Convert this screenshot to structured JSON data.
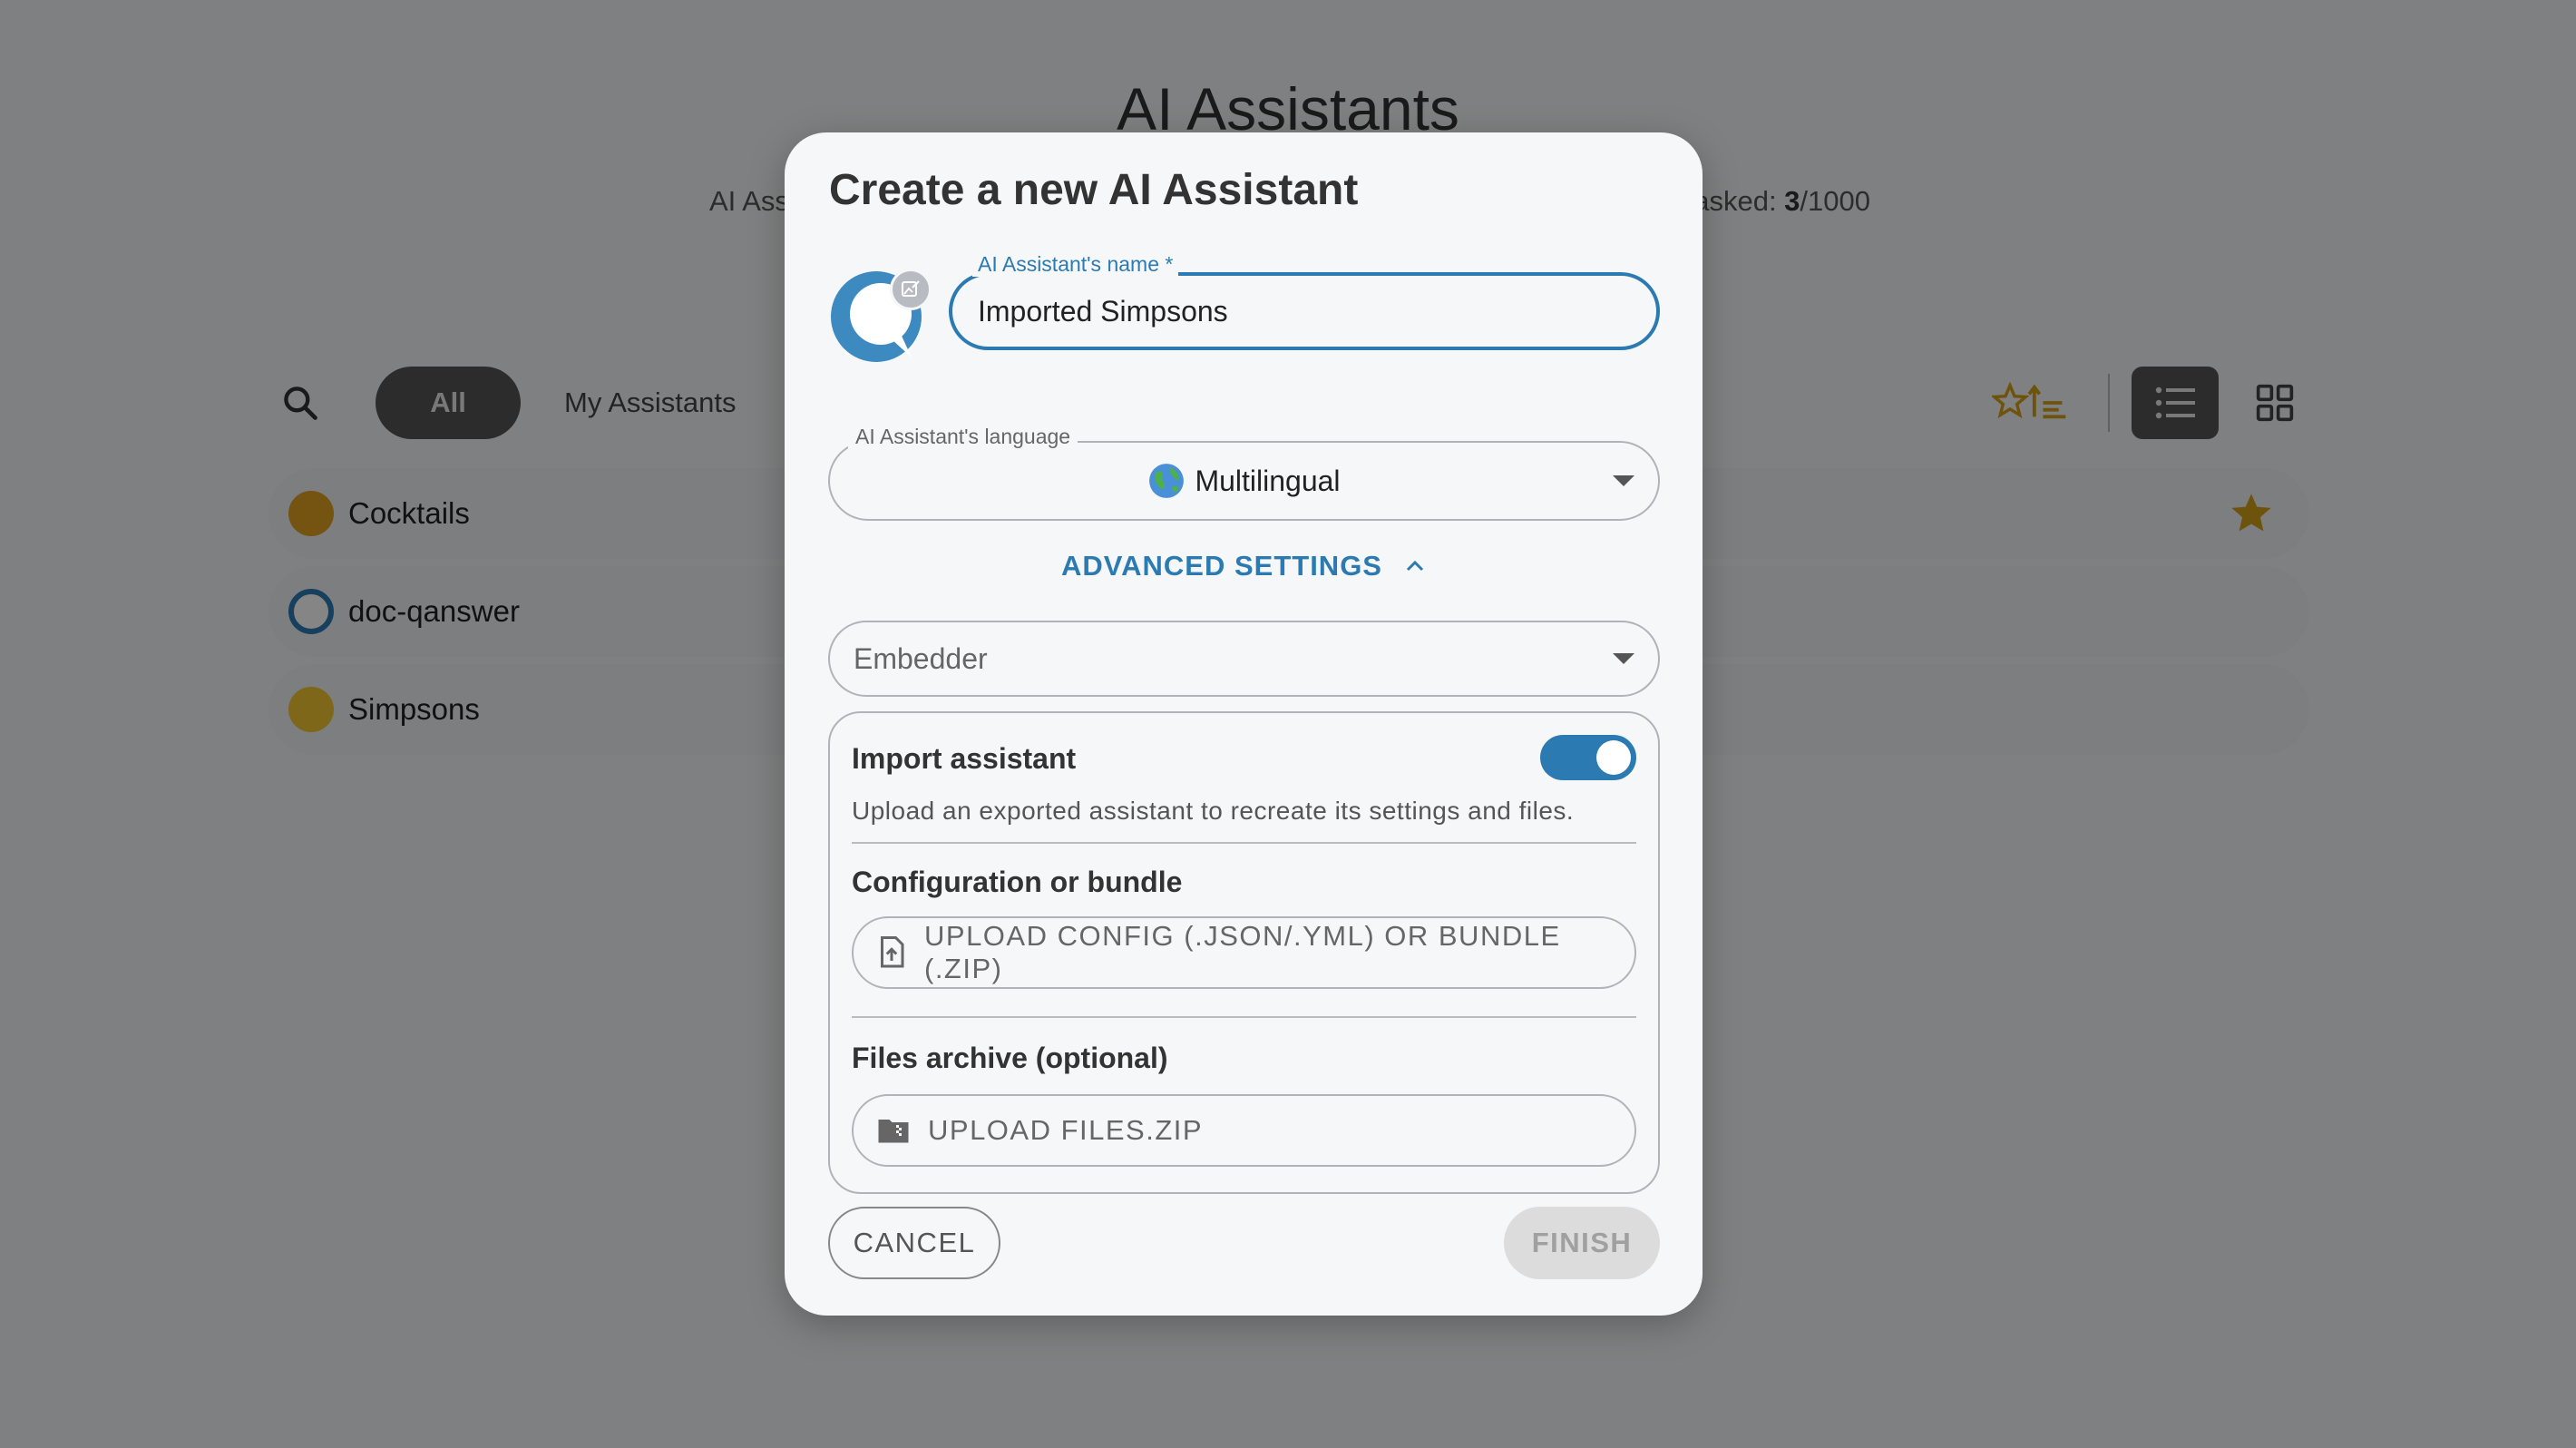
{
  "page": {
    "title": "AI Assistants",
    "stats_left": "AI Assistants",
    "stats_right_prefix": "Questions asked: ",
    "stats_used": "3",
    "stats_total": "/1000"
  },
  "filters": {
    "all_label": "All",
    "mine_label": "My Assistants"
  },
  "assistants": [
    {
      "name": "Cocktails",
      "favorite": true
    },
    {
      "name": "doc-qanswer",
      "favorite": false
    },
    {
      "name": "Simpsons",
      "favorite": false
    }
  ],
  "modal": {
    "title": "Create a new AI Assistant",
    "name_label": "AI Assistant's name *",
    "name_value": "Imported Simpsons",
    "language_label": "AI Assistant's language",
    "language_value": "Multilingual",
    "advanced_label": "ADVANCED SETTINGS",
    "embedder_placeholder": "Embedder",
    "import": {
      "title": "Import assistant",
      "enabled": true,
      "description": "Upload an exported assistant to recreate its settings and files.",
      "config_title": "Configuration or bundle",
      "config_button": "UPLOAD CONFIG (.JSON/.YML) OR BUNDLE (.ZIP)",
      "files_title": "Files archive (optional)",
      "files_button": "UPLOAD FILES.ZIP"
    },
    "cancel_label": "CANCEL",
    "finish_label": "FINISH"
  },
  "colors": {
    "accent": "#2b7bb2",
    "favorite": "#d4a017",
    "overlay": "rgba(0,0,0,0.48)"
  }
}
